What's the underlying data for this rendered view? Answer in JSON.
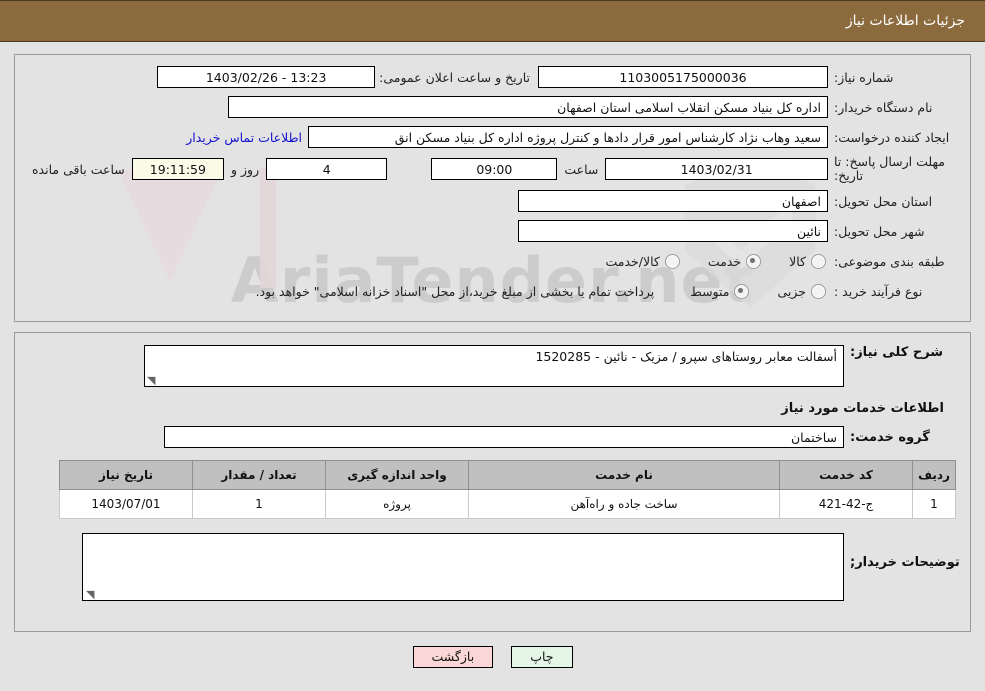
{
  "header": {
    "title": "جزئیات اطلاعات نیاز"
  },
  "form": {
    "need_number_label": "شماره نیاز:",
    "need_number_value": "1103005175000036",
    "public_announce_label": "تاریخ و ساعت اعلان عمومی:",
    "public_announce_value": "13:23 - 1403/02/26",
    "buyer_org_label": "نام دستگاه خریدار:",
    "buyer_org_value": "اداره کل بنیاد مسکن انقلاب اسلامی استان اصفهان",
    "creator_label": "ایجاد کننده درخواست:",
    "creator_value": "سعید وهاب نژاد کارشناس امور قرار دادها و کنترل  پروژه اداره کل بنیاد مسکن انق",
    "contact_link": "اطلاعات تماس خریدار",
    "deadline_label_line1": "مهلت ارسال پاسخ: تا",
    "deadline_label_line2": "تاریخ:",
    "deadline_date": "1403/02/31",
    "hour_word": "ساعت",
    "deadline_time": "09:00",
    "days_value": "4",
    "days_word": "روز و",
    "countdown_value": "19:11:59",
    "remaining_word": "ساعت باقی مانده",
    "province_label": "استان محل تحویل:",
    "province_value": "اصفهان",
    "city_label": "شهر محل تحویل:",
    "city_value": "نائین",
    "category_label": "طبقه بندی موضوعی:",
    "category_options": [
      {
        "label": "کالا",
        "selected": false
      },
      {
        "label": "خدمت",
        "selected": true
      },
      {
        "label": "کالا/خدمت",
        "selected": false
      }
    ],
    "process_label": "نوع فرآیند خرید :",
    "process_options": [
      {
        "label": "جزیی",
        "selected": false
      },
      {
        "label": "متوسط",
        "selected": true
      }
    ],
    "payment_note": "پرداخت تمام یا بخشی از مبلغ خرید،از محل \"اسناد خزانه اسلامی\" خواهد بود."
  },
  "detail": {
    "general_desc_label": "شرح کلی نیاز:",
    "general_desc_value": "أسفالت معابر روستاهای سپرو / مزیک - نائین - 1520285",
    "services_section_title": "اطلاعات خدمات مورد نیاز",
    "service_group_label": "گروه خدمت:",
    "service_group_value": "ساختمان",
    "table": {
      "columns": [
        "ردیف",
        "کد خدمت",
        "نام خدمت",
        "واحد اندازه گیری",
        "تعداد / مقدار",
        "تاریخ نیاز"
      ],
      "rows": [
        [
          "1",
          "ج-42-421",
          "ساخت جاده و راه‌آهن",
          "پروژه",
          "1",
          "1403/07/01"
        ]
      ]
    },
    "buyer_notes_label": "توضیحات خریدار;",
    "buyer_notes_value": ""
  },
  "footer": {
    "print_label": "چاپ",
    "back_label": "بازگشت"
  },
  "watermark": {
    "text": "AriaTender.net"
  },
  "colors": {
    "header_bg": "#8b6b3d",
    "page_bg": "#e3e3e3",
    "link": "#1313cf",
    "print_btn": "#e6f6e6",
    "back_btn": "#fbd6d6",
    "countdown_bg": "#fbfbe8"
  }
}
